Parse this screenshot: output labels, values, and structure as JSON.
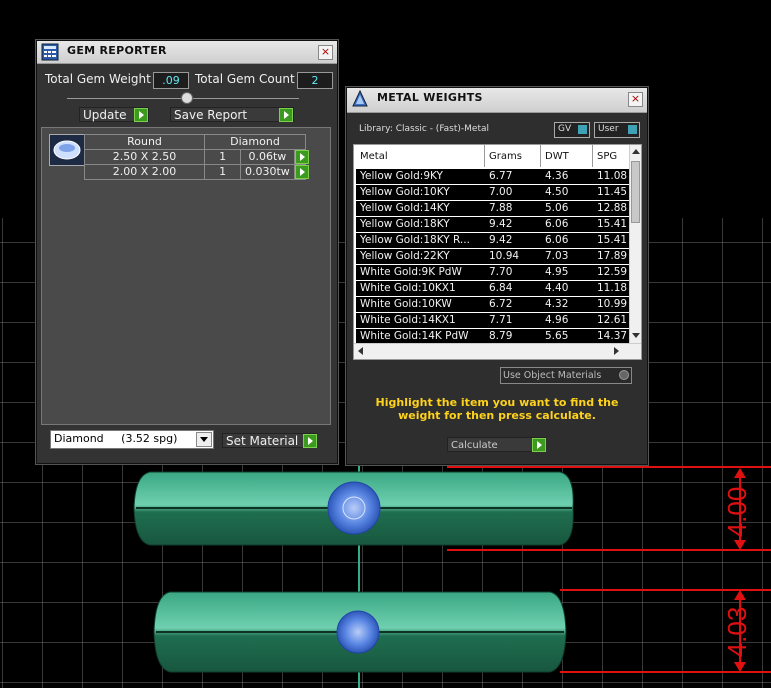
{
  "gem_reporter": {
    "title": "GEM REPORTER",
    "close_label": "×",
    "total_weight_label": "Total Gem Weight",
    "total_weight_value": ".09",
    "total_count_label": "Total Gem Count",
    "total_count_value": "2",
    "update_label": "Update",
    "save_report_label": "Save Report",
    "table": {
      "shape_header": "Round",
      "type_header": "Diamond",
      "rows": [
        {
          "size": "2.50 X 2.50",
          "qty": "1",
          "weight": "0.06tw"
        },
        {
          "size": "2.00 X 2.00",
          "qty": "1",
          "weight": "0.030tw"
        }
      ]
    },
    "material_select": "Diamond     (3.52 spg)",
    "set_material_label": "Set Material"
  },
  "metal_weights": {
    "title": "METAL WEIGHTS",
    "close_label": "×",
    "library_label": "Library: Classic - (Fast)-Metal",
    "gv_label": "GV",
    "user_label": "User",
    "columns": [
      "Metal",
      "Grams",
      "DWT",
      "SPG"
    ],
    "rows": [
      {
        "metal": "Yellow Gold:9KY",
        "grams": "6.77",
        "dwt": "4.36",
        "spg": "11.08"
      },
      {
        "metal": "Yellow Gold:10KY",
        "grams": "7.00",
        "dwt": "4.50",
        "spg": "11.45"
      },
      {
        "metal": "Yellow Gold:14KY",
        "grams": "7.88",
        "dwt": "5.06",
        "spg": "12.88"
      },
      {
        "metal": "Yellow Gold:18KY",
        "grams": "9.42",
        "dwt": "6.06",
        "spg": "15.41"
      },
      {
        "metal": "Yellow Gold:18KY R...",
        "grams": "9.42",
        "dwt": "6.06",
        "spg": "15.41"
      },
      {
        "metal": "Yellow Gold:22KY",
        "grams": "10.94",
        "dwt": "7.03",
        "spg": "17.89"
      },
      {
        "metal": "White Gold:9K PdW",
        "grams": "7.70",
        "dwt": "4.95",
        "spg": "12.59"
      },
      {
        "metal": "White Gold:10KX1",
        "grams": "6.84",
        "dwt": "4.40",
        "spg": "11.18"
      },
      {
        "metal": "White Gold:10KW",
        "grams": "6.72",
        "dwt": "4.32",
        "spg": "10.99"
      },
      {
        "metal": "White Gold:14KX1",
        "grams": "7.71",
        "dwt": "4.96",
        "spg": "12.61"
      },
      {
        "metal": "White Gold:14K PdW",
        "grams": "8.79",
        "dwt": "5.65",
        "spg": "14.37"
      }
    ],
    "use_object_materials_label": "Use Object Materials",
    "instruction": "Highlight the item you want to find the weight for then press calculate.",
    "calculate_label": "Calculate"
  },
  "viewport": {
    "dimension_top": "4.00",
    "dimension_bottom": "4.03",
    "colors": {
      "dimension": "#e01010",
      "ring": "#2d8f6a",
      "gem": "#4a7fe0",
      "grid": "#7a7a7a"
    }
  }
}
